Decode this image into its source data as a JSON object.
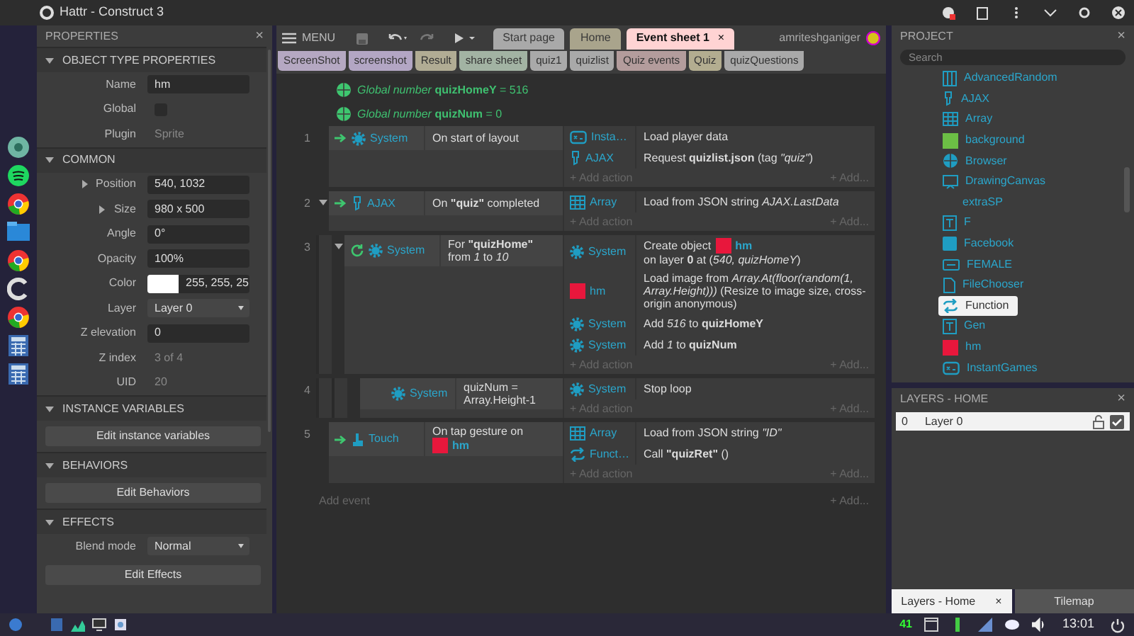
{
  "window": {
    "title": "Hattr - Construct 3"
  },
  "properties": {
    "title": "PROPERTIES",
    "close": "×",
    "sections": [
      {
        "title": "OBJECT TYPE PROPERTIES",
        "expanded": true,
        "rows": [
          {
            "kind": "text",
            "label": "Name",
            "value": "hm"
          },
          {
            "kind": "check",
            "label": "Global",
            "checked": false
          },
          {
            "kind": "static",
            "label": "Plugin",
            "value": "Sprite"
          }
        ]
      },
      {
        "title": "COMMON",
        "expanded": true,
        "rows": [
          {
            "kind": "text",
            "label": "Position",
            "value": "540, 1032",
            "expandable": true
          },
          {
            "kind": "text",
            "label": "Size",
            "value": "980 x 500",
            "expandable": true
          },
          {
            "kind": "text",
            "label": "Angle",
            "value": "0°"
          },
          {
            "kind": "text",
            "label": "Opacity",
            "value": "100%"
          },
          {
            "kind": "color",
            "label": "Color",
            "color": "#ffffff",
            "value": "255, 255, 25"
          },
          {
            "kind": "select",
            "label": "Layer",
            "value": "Layer 0"
          },
          {
            "kind": "text",
            "label": "Z elevation",
            "value": "0"
          },
          {
            "kind": "static",
            "label": "Z index",
            "value": "3 of 4"
          },
          {
            "kind": "static",
            "label": "UID",
            "value": "20"
          }
        ]
      },
      {
        "title": "INSTANCE VARIABLES",
        "expanded": true,
        "rows": [
          {
            "kind": "button",
            "value": "Edit instance variables"
          }
        ]
      },
      {
        "title": "BEHAVIORS",
        "expanded": true,
        "rows": [
          {
            "kind": "button",
            "value": "Edit Behaviors"
          }
        ]
      },
      {
        "title": "EFFECTS",
        "expanded": true,
        "rows": [
          {
            "kind": "select",
            "label": "Blend mode",
            "value": "Normal"
          },
          {
            "kind": "button",
            "value": "Edit Effects"
          }
        ]
      }
    ]
  },
  "editor": {
    "menu": "MENU",
    "user": "amriteshganiger",
    "tabs": [
      {
        "label": "Start page",
        "color": "#a9a9a9",
        "selected": false
      },
      {
        "label": "Home",
        "color": "#a9a48c",
        "selected": false
      },
      {
        "label": "Event sheet 1",
        "color": "#ffd3d3",
        "selected": true,
        "close": "×"
      }
    ],
    "sheet_tabs": [
      {
        "label": "ScreenShot",
        "color": "#b5a8c2"
      },
      {
        "label": "screenshot",
        "color": "#b3a6c4"
      },
      {
        "label": "Result",
        "color": "#b1ac94"
      },
      {
        "label": "share sheet",
        "color": "#a2b3a3"
      },
      {
        "label": "quiz1",
        "color": "#a9a9a9"
      },
      {
        "label": "quizlist",
        "color": "#a9a9a9"
      },
      {
        "label": "Quiz events",
        "color": "#b39c9c"
      },
      {
        "label": "Quiz",
        "color": "#b3ad90"
      },
      {
        "label": "quizQuestions",
        "color": "#a9a9a9"
      }
    ],
    "globals": [
      "*Global number* **quizHomeY** = 516",
      "*Global number* **quizNum** = 0"
    ],
    "events": [
      {
        "number": "1",
        "kind": "trigger",
        "conditions": [
          {
            "kind": "system",
            "object": "System",
            "text": "On start of layout"
          }
        ],
        "actions": [
          {
            "kind": "instant",
            "object": "Insta…",
            "text": "Load player data"
          },
          {
            "kind": "ajax",
            "object": "AJAX",
            "text": "Request **quizlist.json** (tag *\"quiz\"*)"
          }
        ],
        "add_action": "+ Add action",
        "add_other": "+ Add..."
      },
      {
        "number": "2",
        "kind": "trigger",
        "expanded": true,
        "conditions": [
          {
            "kind": "ajax",
            "object": "AJAX",
            "text": "On **\"quiz\"** completed"
          }
        ],
        "actions": [
          {
            "kind": "array",
            "object": "Array",
            "text": "Load from JSON string *AJAX.LastData*"
          }
        ],
        "add_action": "+ Add action",
        "add_other": "+ Add...",
        "children": [
          {
            "number": "3",
            "kind": "loop",
            "expanded": true,
            "conditions": [
              {
                "kind": "system",
                "object": "System",
                "text": "For **\"quizHome\"** from *1* to *10*"
              }
            ],
            "actions": [
              {
                "kind": "system",
                "object": "System",
                "parts": [
                  {
                    "kind": "text",
                    "text": "Create object"
                  },
                  {
                    "kind": "sprite",
                    "color": "#e8173c",
                    "text": "hm"
                  },
                  {
                    "kind": "text",
                    "text": "on layer **0** at (*540, quizHomeY*)"
                  }
                ]
              },
              {
                "kind": "sprite",
                "color": "#e8173c",
                "object": "hm",
                "text": "Load image from *Array.At(floor(random(1, Array.Height)))* (Resize to image size, cross-origin anonymous)"
              },
              {
                "kind": "system",
                "object": "System",
                "text": "Add *516* to **quizHomeY**"
              },
              {
                "kind": "system",
                "object": "System",
                "text": "Add *1* to **quizNum**"
              }
            ],
            "add_action": "+ Add action",
            "add_other": "+ Add...",
            "children": [
              {
                "number": "4",
                "conditions": [
                  {
                    "kind": "system",
                    "object": "System",
                    "text": "quizNum = Array.Height-1"
                  }
                ],
                "actions": [
                  {
                    "kind": "system",
                    "object": "System",
                    "text": "Stop loop"
                  }
                ],
                "add_action": "+ Add action",
                "add_other": "+ Add..."
              }
            ]
          }
        ]
      },
      {
        "number": "5",
        "kind": "trigger",
        "conditions": [
          {
            "kind": "touch",
            "object": "Touch",
            "parts": [
              {
                "kind": "text",
                "text": "On tap gesture on"
              },
              {
                "kind": "sprite",
                "color": "#e8173c",
                "text": "hm"
              }
            ]
          }
        ],
        "actions": [
          {
            "kind": "array",
            "object": "Array",
            "text": "Load from JSON string *\"ID\"*"
          },
          {
            "kind": "function",
            "object": "Funct…",
            "text": "Call **\"quizRet\"** ()"
          }
        ],
        "add_action": "+ Add action",
        "add_other": "+ Add..."
      }
    ],
    "add_event": "Add event",
    "add_event_other": "+ Add..."
  },
  "project": {
    "title": "PROJECT",
    "close": "×",
    "search": {
      "placeholder": "Search"
    },
    "items": [
      {
        "label": "AdvancedRandom",
        "kind": "advrandom",
        "selected": false
      },
      {
        "label": "AJAX",
        "kind": "ajax",
        "selected": false
      },
      {
        "label": "Array",
        "kind": "array",
        "selected": false
      },
      {
        "label": "background",
        "kind": "sprite",
        "color": "#6cbf45",
        "selected": false
      },
      {
        "label": "Browser",
        "kind": "globe",
        "selected": false
      },
      {
        "label": "DrawingCanvas",
        "kind": "drawing",
        "selected": false
      },
      {
        "label": "extraSP",
        "selected": false
      },
      {
        "label": "F",
        "kind": "textbox",
        "selected": false
      },
      {
        "label": "Facebook",
        "kind": "facebook",
        "selected": false
      },
      {
        "label": "FEMALE",
        "kind": "buttonobj",
        "selected": false
      },
      {
        "label": "FileChooser",
        "kind": "file",
        "selected": false
      },
      {
        "label": "Function",
        "kind": "function",
        "selected": true
      },
      {
        "label": "Gen",
        "kind": "textbox",
        "selected": false
      },
      {
        "label": "hm",
        "kind": "sprite",
        "color": "#e8173c",
        "selected": false
      },
      {
        "label": "InstantGames",
        "kind": "instant",
        "selected": false
      }
    ]
  },
  "layers": {
    "title": "LAYERS - HOME",
    "close": "×",
    "rows": [
      {
        "index": "0",
        "name": "Layer 0",
        "locked": false,
        "visible": true,
        "selected": true
      }
    ]
  },
  "bottom_tabs": [
    {
      "label": "Layers - Home",
      "selected": true,
      "close": "×"
    },
    {
      "label": "Tilemap",
      "selected": false
    }
  ],
  "taskbar": {
    "counter": "41",
    "clock": "13:01"
  }
}
